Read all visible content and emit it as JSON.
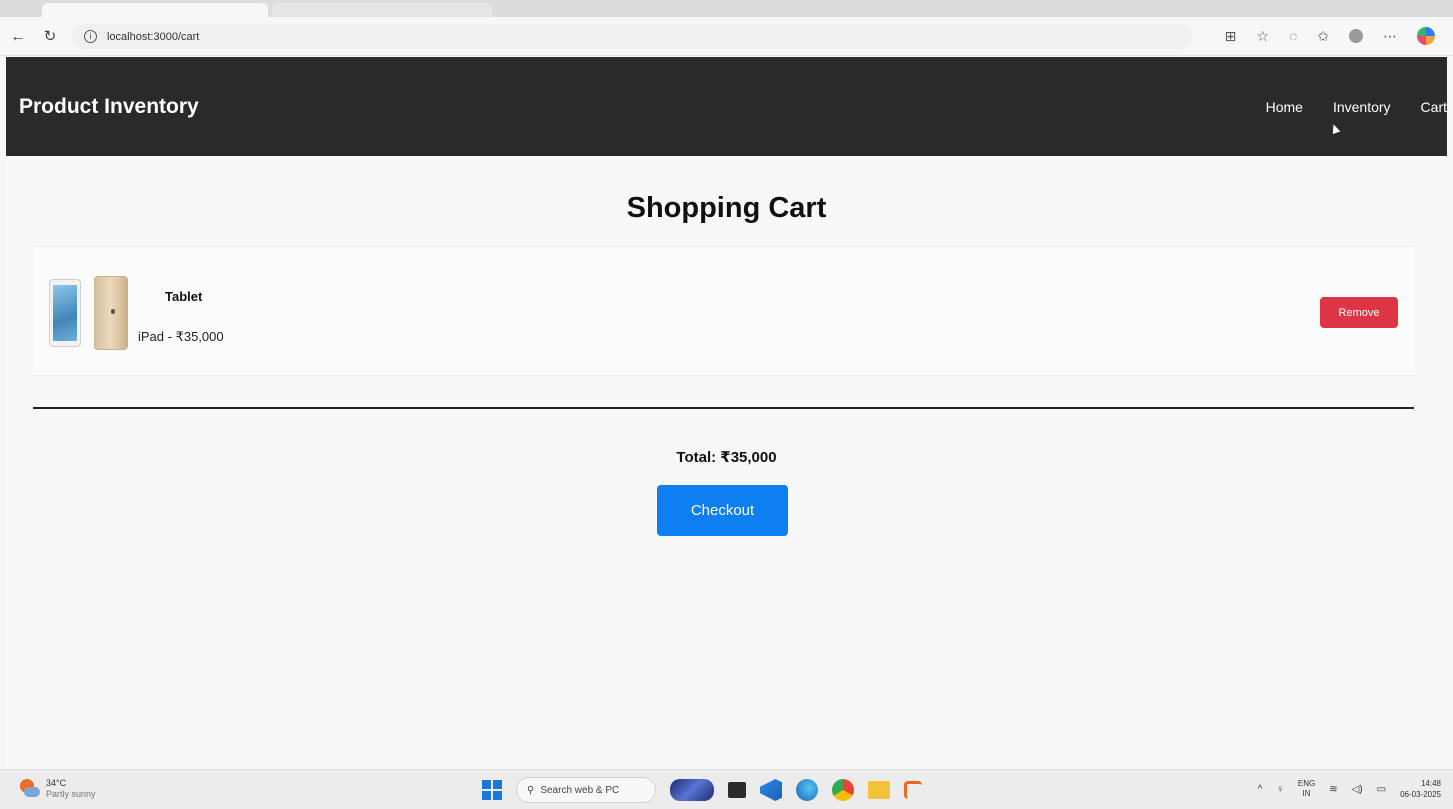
{
  "browser": {
    "url": "localhost:3000/cart"
  },
  "navbar": {
    "brand": "Product Inventory",
    "links": [
      "Home",
      "Inventory",
      "Cart"
    ]
  },
  "page": {
    "title": "Shopping Cart"
  },
  "cart": {
    "items": [
      {
        "name": "Tablet",
        "description": "iPad - ₹35,000",
        "remove_label": "Remove"
      }
    ],
    "total": "Total: ₹35,000",
    "checkout_label": "Checkout"
  },
  "taskbar": {
    "weather_temp": "34°C",
    "weather_desc": "Partly sunny",
    "search_placeholder": "Search web & PC",
    "lang_line1": "ENG",
    "lang_line2": "IN",
    "time": "14:48",
    "date": "06-03-2025"
  },
  "colors": {
    "navbar_bg": "#2a2a2a",
    "remove_button": "#dc3545",
    "checkout_button": "#0d7ff0"
  },
  "icons": [
    "back-arrow-icon",
    "refresh-icon",
    "info-icon",
    "reader-icon",
    "favorite-icon",
    "extensions-icon",
    "favorites-icon",
    "profile-icon",
    "more-icon",
    "copilot-icon"
  ]
}
